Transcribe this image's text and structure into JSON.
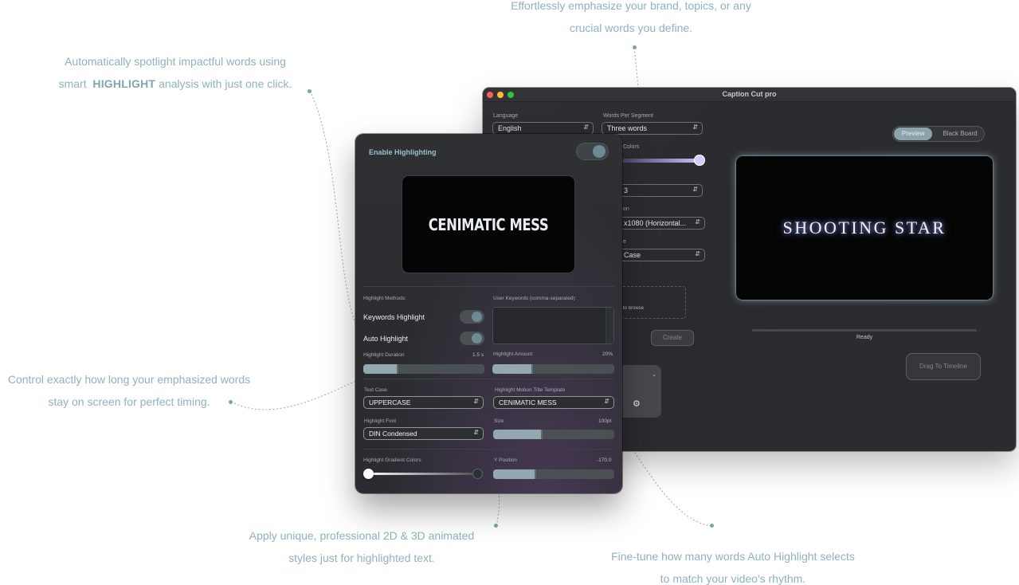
{
  "callouts": {
    "top": {
      "line1": "Effortlessly emphasize your brand, topics, or any",
      "line2": "crucial words you define."
    },
    "left_top": {
      "line1": "Automatically spotlight impactful words using",
      "line2_pre": "smart",
      "line2_bold": "HIGHLIGHT",
      "line2_post": "analysis with just one click."
    },
    "left_mid": {
      "line1": "Control exactly how long your emphasized words",
      "line2": "stay on screen for perfect timing."
    },
    "bottom_left": {
      "line1": "Apply unique, professional 2D & 3D animated",
      "line2": "styles just for highlighted text."
    },
    "bottom_right": {
      "line1": "Fine-tune how many words Auto Highlight selects",
      "line2": "to match your video's rhythm."
    }
  },
  "back_window": {
    "title": "Caption Cut pro",
    "language_label": "Language",
    "language_value": "English",
    "words_label": "Words Per Segment",
    "words_value": "Three words",
    "colors_label_partial": "Colors",
    "field_partial_1": "3",
    "resolution_label_partial": "on",
    "resolution_value_partial": "x1080 (Horizontal...",
    "case_label_partial": "e",
    "case_value_partial": "Case",
    "browse_partial": "to browse",
    "create_button": "Create",
    "segment_preview": "Preview",
    "segment_blackboard": "Black Board",
    "preview_text": "SHOOTING STAR",
    "status": "Ready",
    "drag_button": "Drag To Timeline"
  },
  "front_panel": {
    "title": "Enable Highlighting",
    "preview_text": "CENIMATIC MESS",
    "methods_label": "Highlight Methods:",
    "keywords_label": "User Keywords (comma-separated):",
    "keywords_highlight": "Keywords Highlight",
    "auto_highlight": "Auto Highlight",
    "duration_label": "Highlight Duration",
    "duration_value": "1.5 s",
    "amount_label": "Highlight Amount",
    "amount_value": "20%",
    "text_case_label": "Text Case",
    "text_case_value": "UPPERCASE",
    "motion_label": "Highlight Motion Title Template",
    "motion_value": "CENIMATIC MESS",
    "font_label": "Highlight Font",
    "font_value": "DIN Condensed",
    "size_label": "Size",
    "size_value": "100pt",
    "gradient_label": "Highlight Gradient Colors",
    "ypos_label": "Y Position",
    "ypos_value": "-170.0"
  },
  "levels": {
    "duration": 0.28,
    "amount": 0.33,
    "size": 0.4,
    "ypos": 0.35
  }
}
